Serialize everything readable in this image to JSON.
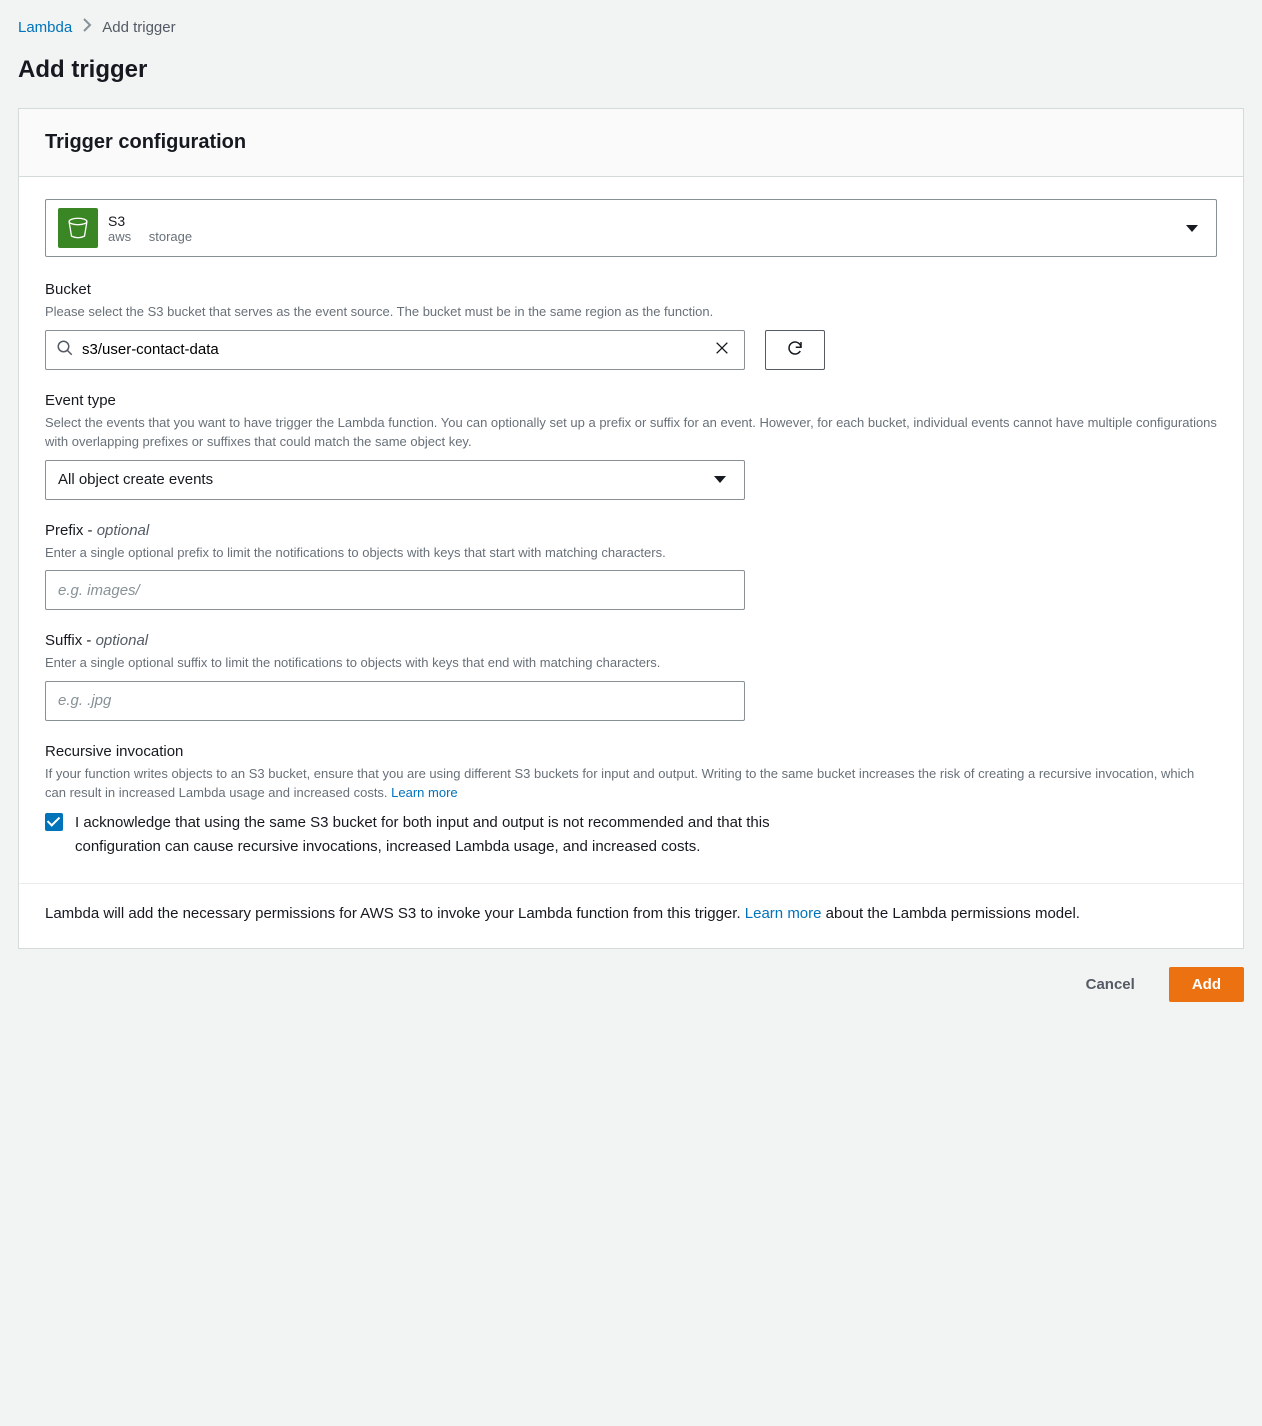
{
  "breadcrumb": {
    "root": "Lambda",
    "current": "Add trigger"
  },
  "page_title": "Add trigger",
  "panel_title": "Trigger configuration",
  "source": {
    "name": "S3",
    "vendor": "aws",
    "category": "storage"
  },
  "bucket": {
    "label": "Bucket",
    "hint": "Please select the S3 bucket that serves as the event source. The bucket must be in the same region as the function.",
    "value": "s3/user-contact-data"
  },
  "event_type": {
    "label": "Event type",
    "hint": "Select the events that you want to have trigger the Lambda function. You can optionally set up a prefix or suffix for an event. However, for each bucket, individual events cannot have multiple configurations with overlapping prefixes or suffixes that could match the same object key.",
    "selected": "All object create events"
  },
  "prefix": {
    "label": "Prefix - ",
    "optional": "optional",
    "hint": "Enter a single optional prefix to limit the notifications to objects with keys that start with matching characters.",
    "placeholder": "e.g. images/"
  },
  "suffix": {
    "label": "Suffix - ",
    "optional": "optional",
    "hint": "Enter a single optional suffix to limit the notifications to objects with keys that end with matching characters.",
    "placeholder": "e.g. .jpg"
  },
  "recursive": {
    "label": "Recursive invocation",
    "hint_pre": "If your function writes objects to an S3 bucket, ensure that you are using different S3 buckets for input and output. Writing to the same bucket increases the risk of creating a recursive invocation, which can result in increased Lambda usage and increased costs. ",
    "learn_more": "Learn more",
    "ack": "I acknowledge that using the same S3 bucket for both input and output is not recommended and that this configuration can cause recursive invocations, increased Lambda usage, and increased costs."
  },
  "footer": {
    "text_pre": "Lambda will add the necessary permissions for AWS S3 to invoke your Lambda function from this trigger. ",
    "learn_more": "Learn more",
    "text_post": " about the Lambda permissions model."
  },
  "actions": {
    "cancel": "Cancel",
    "add": "Add"
  }
}
